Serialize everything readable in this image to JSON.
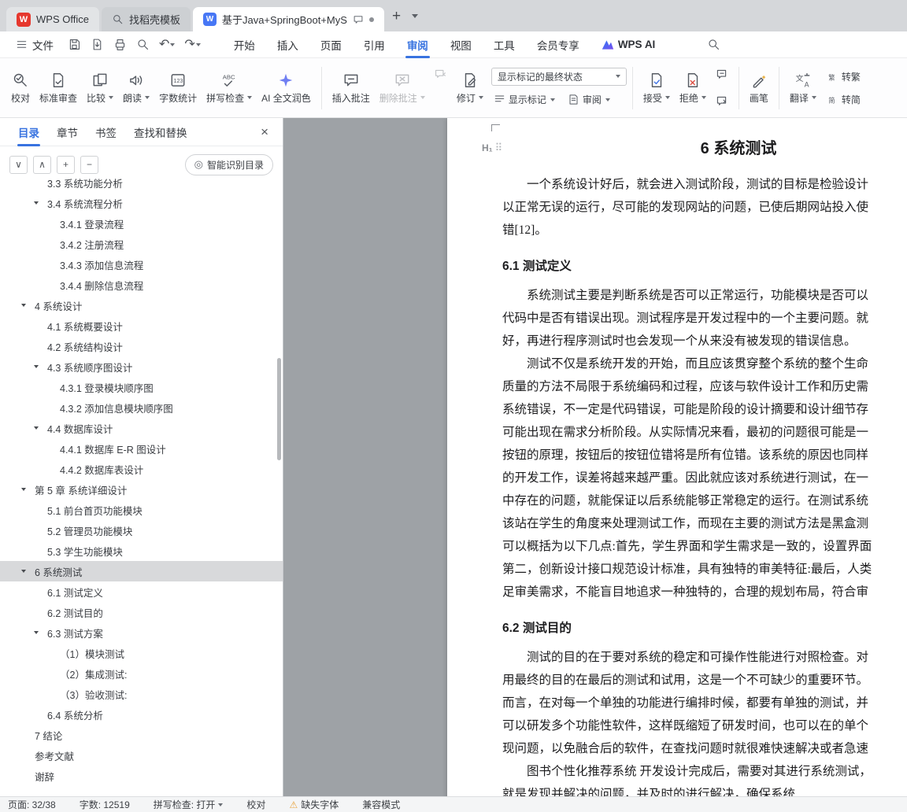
{
  "accent": {
    "blue": "#3873e0",
    "red": "#e23d30",
    "warn": "#e8a33d"
  },
  "tabbar": {
    "tabs": [
      {
        "label": "WPS Office"
      },
      {
        "label": "找稻壳模板"
      },
      {
        "label": "基于Java+SpringBoot+MyS",
        "active": true
      }
    ]
  },
  "menubar": {
    "file_label": "文件",
    "items": [
      {
        "label": "开始"
      },
      {
        "label": "插入"
      },
      {
        "label": "页面"
      },
      {
        "label": "引用"
      },
      {
        "label": "审阅",
        "active": true
      },
      {
        "label": "视图"
      },
      {
        "label": "工具"
      },
      {
        "label": "会员专享"
      }
    ],
    "ai_label": "WPS AI"
  },
  "ribbon": {
    "proofread": "校对",
    "standard": "标准审查",
    "compare": "比较",
    "read_aloud": "朗读",
    "word_count": "字数统计",
    "spellcheck": "拼写检查",
    "ai_polish": "AI 全文润色",
    "insert_comment": "插入批注",
    "delete_comment": "删除批注",
    "revise": "修订",
    "markup_state": "显示标记的最终状态",
    "show_markup": "显示标记",
    "review": "审阅",
    "accept": "接受",
    "reject": "拒绝",
    "pen": "画笔",
    "translate": "翻译",
    "to_traditional": "转繁",
    "to_simplified": "转简"
  },
  "sidebar": {
    "tabs": [
      {
        "label": "目录",
        "active": true
      },
      {
        "label": "章节"
      },
      {
        "label": "书签"
      },
      {
        "label": "查找和替换"
      }
    ],
    "smart_button": "智能识别目录",
    "outline": [
      {
        "label": "3.3 系统功能分析",
        "level": 2
      },
      {
        "label": "3.4 系统流程分析",
        "level": 2,
        "arrow": true
      },
      {
        "label": "3.4.1 登录流程",
        "level": 3
      },
      {
        "label": "3.4.2 注册流程",
        "level": 3
      },
      {
        "label": "3.4.3 添加信息流程",
        "level": 3
      },
      {
        "label": "3.4.4 删除信息流程",
        "level": 3
      },
      {
        "label": "4 系统设计",
        "level": 1,
        "arrow": true
      },
      {
        "label": "4.1 系统概要设计",
        "level": 2
      },
      {
        "label": "4.2 系统结构设计",
        "level": 2
      },
      {
        "label": "4.3 系统顺序图设计",
        "level": 2,
        "arrow": true
      },
      {
        "label": "4.3.1 登录模块顺序图",
        "level": 3
      },
      {
        "label": "4.3.2 添加信息模块顺序图",
        "level": 3
      },
      {
        "label": "4.4 数据库设计",
        "level": 2,
        "arrow": true
      },
      {
        "label": "4.4.1 数据库 E-R 图设计",
        "level": 3
      },
      {
        "label": "4.4.2 数据库表设计",
        "level": 3
      },
      {
        "label": "第 5 章 系统详细设计",
        "level": 1,
        "arrow": true
      },
      {
        "label": "5.1 前台首页功能模块",
        "level": 2
      },
      {
        "label": "5.2 管理员功能模块",
        "level": 2
      },
      {
        "label": "5.3 学生功能模块",
        "level": 2
      },
      {
        "label": "6 系统测试",
        "level": 1,
        "arrow": true,
        "selected": true
      },
      {
        "label": "6.1 测试定义",
        "level": 2
      },
      {
        "label": "6.2 测试目的",
        "level": 2
      },
      {
        "label": "6.3 测试方案",
        "level": 2,
        "arrow": true
      },
      {
        "label": "（1）模块测试",
        "level": 3
      },
      {
        "label": "（2）集成测试:",
        "level": 3
      },
      {
        "label": "（3）验收测试:",
        "level": 3
      },
      {
        "label": "6.4 系统分析",
        "level": 2
      },
      {
        "label": "7 结论",
        "level": 1
      },
      {
        "label": "参考文献",
        "level": 1
      },
      {
        "label": "谢辞",
        "level": 1
      }
    ]
  },
  "document": {
    "blocks": [
      {
        "type": "h1",
        "text": "6  系统测试"
      },
      {
        "type": "p",
        "lines": [
          "一个系统设计好后，就会进入测试阶段，测试的目标是检验设计",
          "以正常无误的运行，尽可能的发现网站的问题，已使后期网站投入使",
          "错[12]。"
        ]
      },
      {
        "type": "h2",
        "text": "6.1 测试定义"
      },
      {
        "type": "p",
        "lines": [
          "系统测试主要是判断系统是否可以正常运行，功能模块是否可以",
          "代码中是否有错误出现。测试程序是开发过程中的一个主要问题。就",
          "好，再进行程序测试时也会发现一个从来没有被发现的错误信息。"
        ]
      },
      {
        "type": "p",
        "lines": [
          "测试不仅是系统开发的开始，而且应该贯穿整个系统的整个生命",
          "质量的方法不局限于系统编码和过程，应该与软件设计工作和历史需",
          "系统错误，不一定是代码错误，可能是阶段的设计摘要和设计细节存",
          "可能出现在需求分析阶段。从实际情况来看，最初的问题很可能是一",
          "按钮的原理，按钮后的按钮位错将是所有位错。该系统的原因也同样",
          "的开发工作，误差将越来越严重。因此就应该对系统进行测试，在一",
          "中存在的问题，就能保证以后系统能够正常稳定的运行。在测试系统",
          "该站在学生的角度来处理测试工作，而现在主要的测试方法是黑盒测",
          "可以概括为以下几点:首先，学生界面和学生需求是一致的，设置界面",
          "第二，创新设计接口规范设计标准，具有独特的审美特征:最后，人类",
          "足审美需求，不能盲目地追求一种独特的，合理的规划布局，符合审"
        ]
      },
      {
        "type": "h2",
        "text": "6.2 测试目的"
      },
      {
        "type": "p",
        "lines": [
          "测试的目的在于要对系统的稳定和可操作性能进行对照检查。对",
          "用最终的目的在最后的测试和试用，这是一个不可缺少的重要环节。",
          "而言，在对每一个单独的功能进行编排时候，都要有单独的测试，并",
          "可以研发多个功能性软件，这样既缩短了研发时间，也可以在的单个",
          "现问题，以免融合后的软件，在查找问题时就很难快速解决或者急速"
        ]
      },
      {
        "type": "p",
        "lines": [
          "图书个性化推荐系统 开发设计完成后，需要对其进行系统测试，",
          "就是发现并解决的问题，并及时的进行解决，确保系统"
        ]
      }
    ]
  },
  "statusbar": {
    "page": "页面: 32/38",
    "words": "字数: 12519",
    "spell": "拼写检查: 打开",
    "proof": "校对",
    "missing_font": "缺失字体",
    "compat": "兼容模式"
  }
}
